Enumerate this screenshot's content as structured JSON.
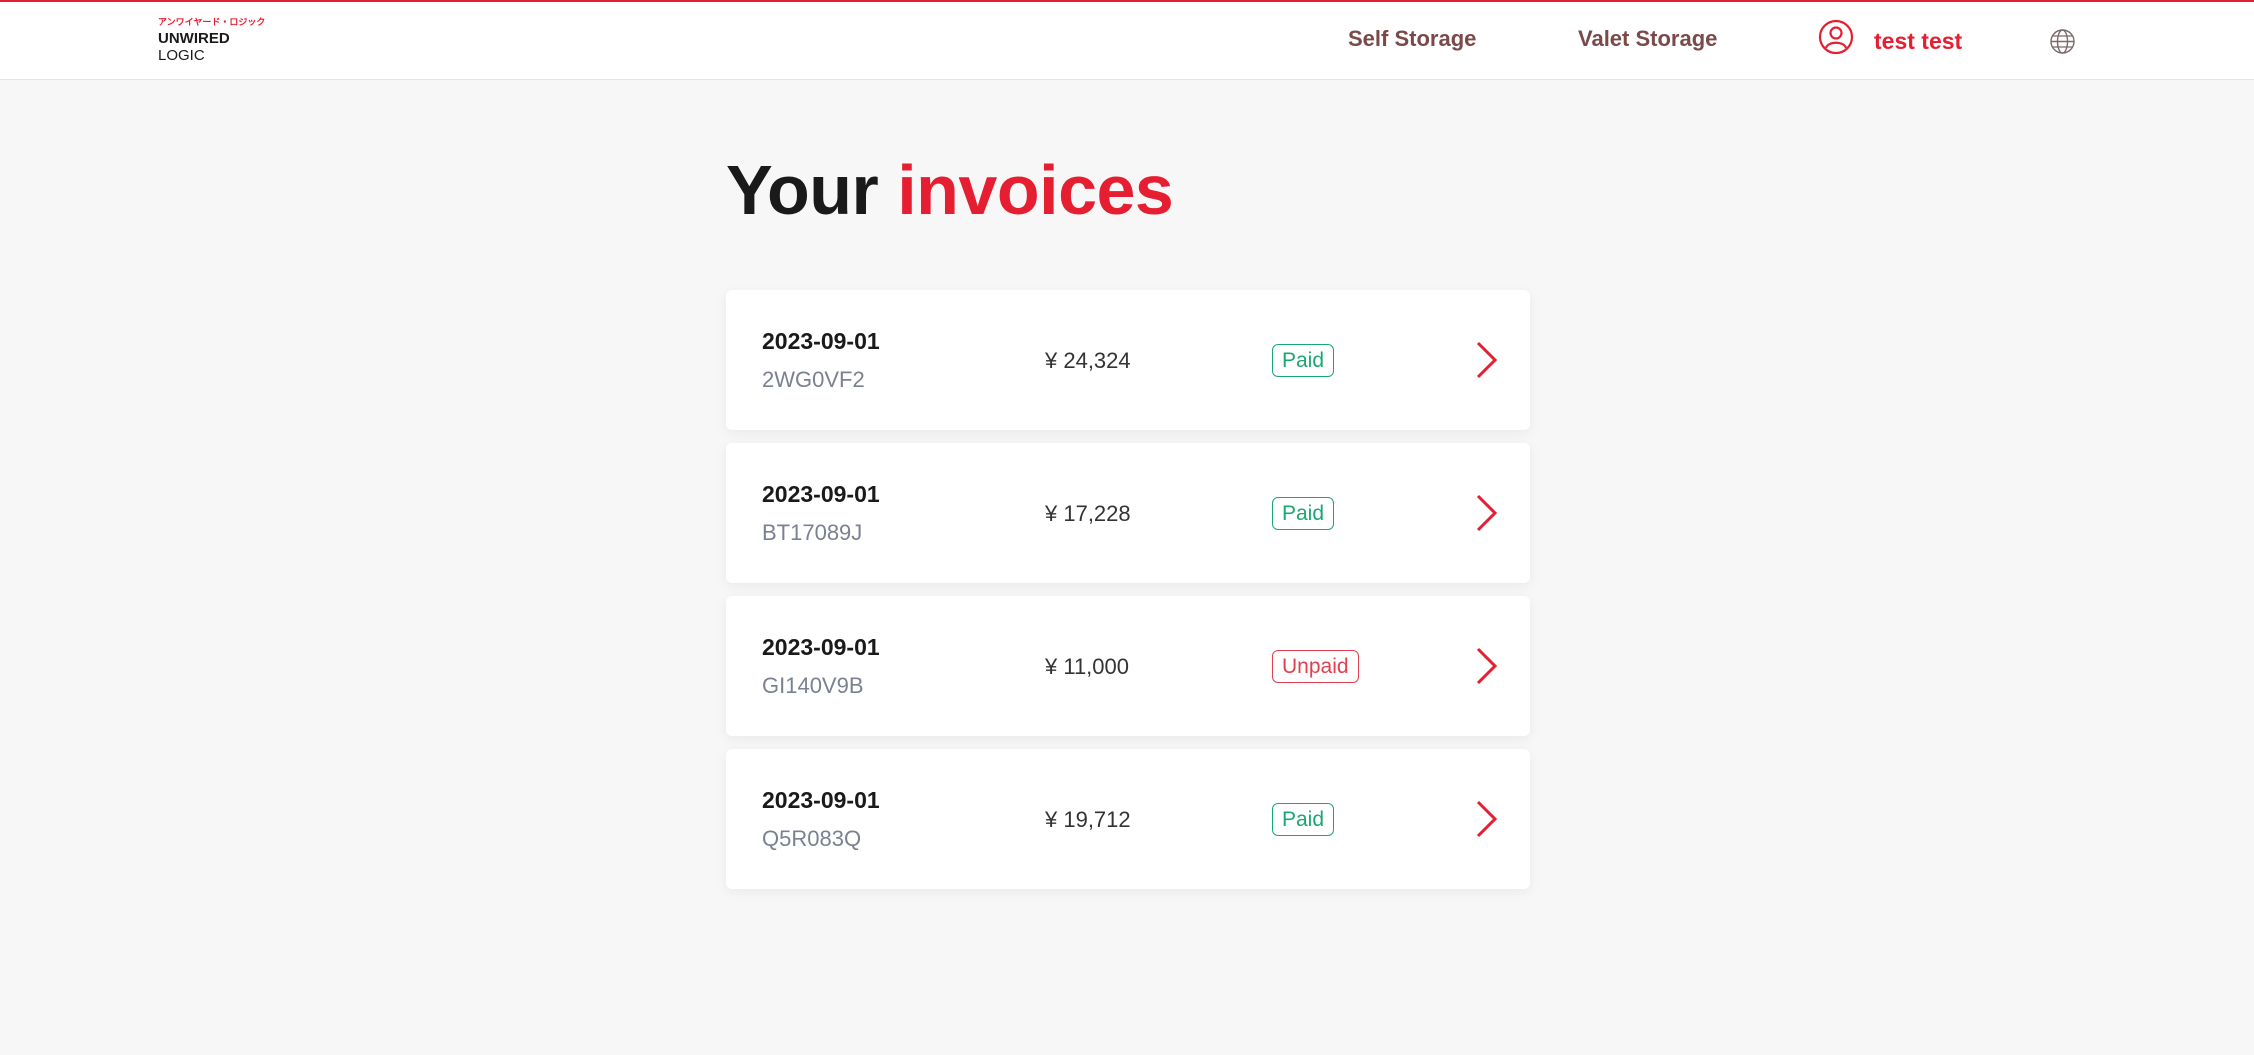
{
  "header": {
    "logo": {
      "jp": "アンワイヤード・ロジック",
      "main": "UNWIRED",
      "sub": "LOGIC"
    },
    "nav": [
      {
        "label": "Self Storage"
      },
      {
        "label": "Valet Storage"
      }
    ],
    "user": {
      "name": "test test",
      "icon": "user-circle-icon"
    },
    "language_icon": "globe-icon"
  },
  "page": {
    "title_prefix": "Your",
    "title_accent": "invoices"
  },
  "invoices": [
    {
      "date": "2023-09-01",
      "code": "2WG0VF2",
      "amount": "¥ 24,324",
      "status": "Paid",
      "status_type": "paid"
    },
    {
      "date": "2023-09-01",
      "code": "BT17089J",
      "amount": "¥ 17,228",
      "status": "Paid",
      "status_type": "paid"
    },
    {
      "date": "2023-09-01",
      "code": "GI140V9B",
      "amount": "¥ 11,000",
      "status": "Unpaid",
      "status_type": "unpaid"
    },
    {
      "date": "2023-09-01",
      "code": "Q5R083Q",
      "amount": "¥ 19,712",
      "status": "Paid",
      "status_type": "paid"
    }
  ],
  "colors": {
    "accent": "#e51e32",
    "paid": "#1aa872",
    "unpaid": "#e0404f",
    "background": "#f7f7f7"
  }
}
